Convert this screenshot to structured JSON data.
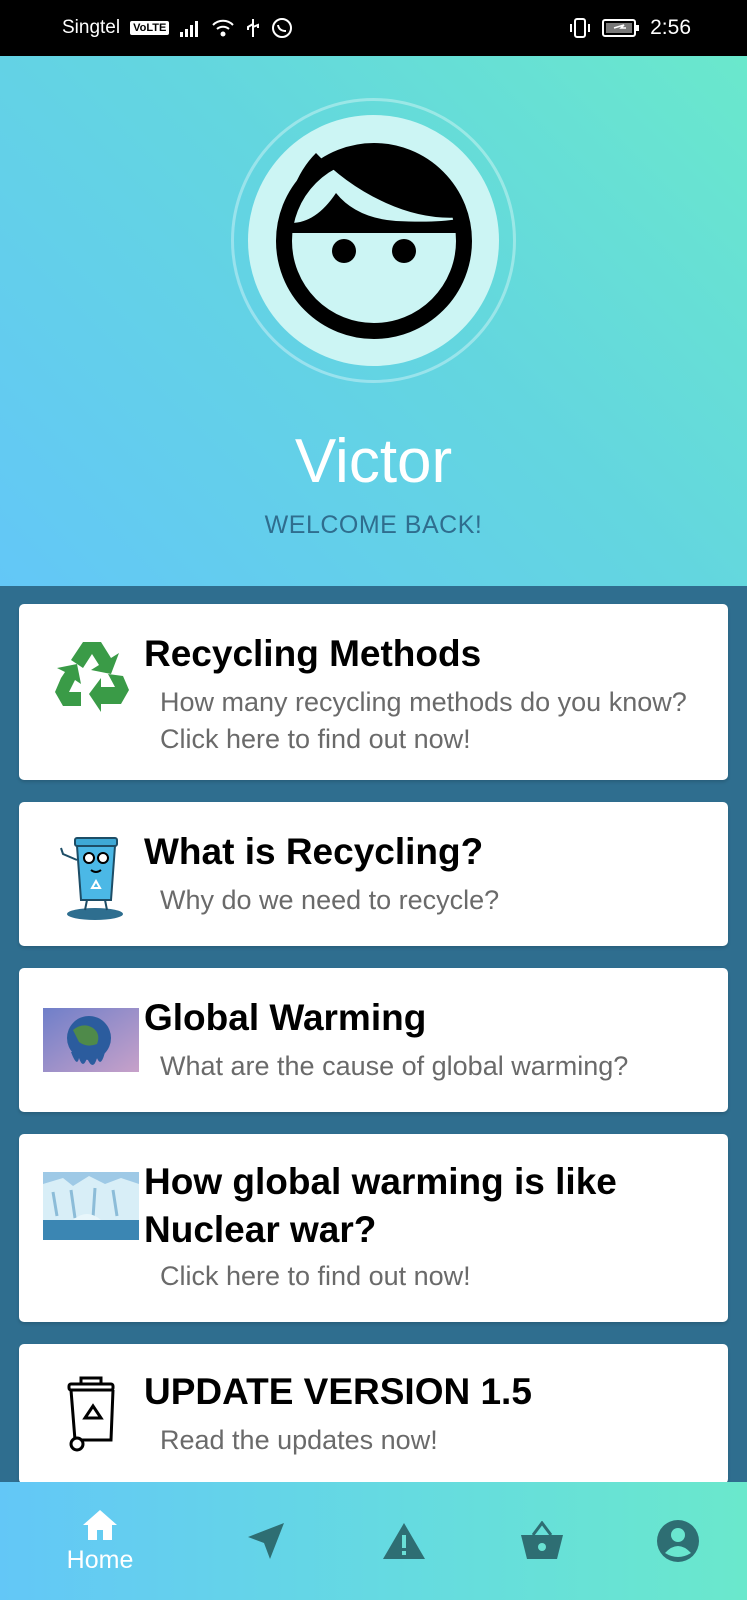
{
  "status_bar": {
    "carrier": "Singtel",
    "volte": "VoLTE",
    "time": "2:56"
  },
  "profile": {
    "name": "Victor",
    "greeting": "WELCOME BACK!"
  },
  "cards": [
    {
      "title": "Recycling Methods",
      "subtitle": "How many recycling methods do you know? Click here to find out now!",
      "icon": "recycle-icon"
    },
    {
      "title": "What is Recycling?",
      "subtitle": "Why do we need to recycle?",
      "icon": "recycle-bin-character-icon"
    },
    {
      "title": "Global Warming",
      "subtitle": "What are the cause of global warming?",
      "icon": "melting-earth-image"
    },
    {
      "title": "How global warming is like Nuclear war?",
      "subtitle": "Click here to find out now!",
      "icon": "glacier-image"
    },
    {
      "title": "UPDATE VERSION 1.5",
      "subtitle": "Read the updates now!",
      "icon": "wheelie-bin-icon"
    }
  ],
  "bottom_nav": {
    "items": [
      {
        "label": "Home",
        "icon": "home-icon",
        "active": true
      },
      {
        "label": "",
        "icon": "navigation-arrow-icon"
      },
      {
        "label": "",
        "icon": "warning-icon"
      },
      {
        "label": "",
        "icon": "basket-icon"
      },
      {
        "label": "",
        "icon": "account-icon"
      }
    ]
  },
  "colors": {
    "accent_dark": "#2f6e8f",
    "nav_icon": "#2e6e73",
    "recycle_green": "#3a9b47"
  }
}
